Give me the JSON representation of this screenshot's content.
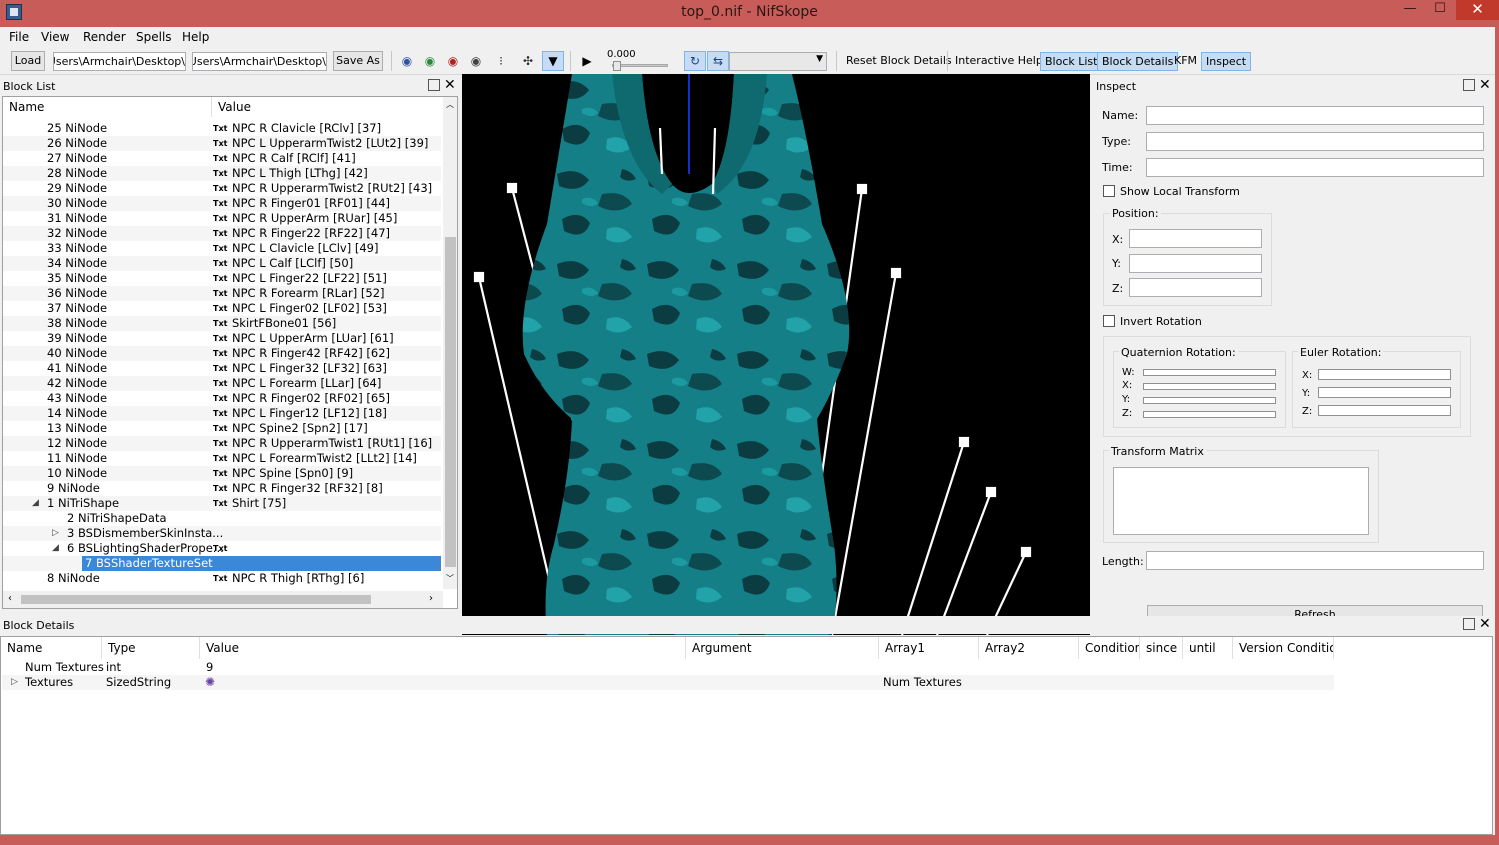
{
  "window": {
    "title": "top_0.nif - NifSkope",
    "min_glyph": "—",
    "max_glyph": "☐",
    "close_glyph": "✕"
  },
  "menu": [
    "File",
    "View",
    "Render",
    "Spells",
    "Help"
  ],
  "toolbar": {
    "load": "Load",
    "path1": "\\Users\\Armchair\\Desktop\\",
    "path2": "\\Users\\Armchair\\Desktop\\",
    "save_as": "Save As",
    "time_value": "0.000",
    "reset_block_details": "Reset Block Details",
    "interactive_help": "Interactive Help",
    "block_list": "Block List",
    "block_details": "Block Details",
    "kfm": "KFM",
    "inspect": "Inspect"
  },
  "block_list": {
    "title": "Block List",
    "col_name": "Name",
    "col_value": "Value",
    "txt_tag": "Txt",
    "rows": [
      {
        "name": "25 NiNode",
        "value": "NPC R Clavicle [RClv] [37]",
        "indent": 0,
        "txt": true
      },
      {
        "name": "26 NiNode",
        "value": "NPC L UpperarmTwist2 [LUt2] [39]",
        "indent": 0,
        "txt": true
      },
      {
        "name": "27 NiNode",
        "value": "NPC R Calf [RClf] [41]",
        "indent": 0,
        "txt": true
      },
      {
        "name": "28 NiNode",
        "value": "NPC L Thigh [LThg] [42]",
        "indent": 0,
        "txt": true
      },
      {
        "name": "29 NiNode",
        "value": "NPC R UpperarmTwist2 [RUt2] [43]",
        "indent": 0,
        "txt": true
      },
      {
        "name": "30 NiNode",
        "value": "NPC R Finger01 [RF01] [44]",
        "indent": 0,
        "txt": true
      },
      {
        "name": "31 NiNode",
        "value": "NPC R UpperArm [RUar] [45]",
        "indent": 0,
        "txt": true
      },
      {
        "name": "32 NiNode",
        "value": "NPC R Finger22 [RF22] [47]",
        "indent": 0,
        "txt": true
      },
      {
        "name": "33 NiNode",
        "value": "NPC L Clavicle [LClv] [49]",
        "indent": 0,
        "txt": true
      },
      {
        "name": "34 NiNode",
        "value": "NPC L Calf [LClf] [50]",
        "indent": 0,
        "txt": true
      },
      {
        "name": "35 NiNode",
        "value": "NPC L Finger22 [LF22] [51]",
        "indent": 0,
        "txt": true
      },
      {
        "name": "36 NiNode",
        "value": "NPC R Forearm [RLar] [52]",
        "indent": 0,
        "txt": true
      },
      {
        "name": "37 NiNode",
        "value": "NPC L Finger02 [LF02] [53]",
        "indent": 0,
        "txt": true
      },
      {
        "name": "38 NiNode",
        "value": "SkirtFBone01 [56]",
        "indent": 0,
        "txt": true
      },
      {
        "name": "39 NiNode",
        "value": "NPC L UpperArm [LUar] [61]",
        "indent": 0,
        "txt": true
      },
      {
        "name": "40 NiNode",
        "value": "NPC R Finger42 [RF42] [62]",
        "indent": 0,
        "txt": true
      },
      {
        "name": "41 NiNode",
        "value": "NPC L Finger32 [LF32] [63]",
        "indent": 0,
        "txt": true
      },
      {
        "name": "42 NiNode",
        "value": "NPC L Forearm [LLar] [64]",
        "indent": 0,
        "txt": true
      },
      {
        "name": "43 NiNode",
        "value": "NPC R Finger02 [RF02] [65]",
        "indent": 0,
        "txt": true
      },
      {
        "name": "14 NiNode",
        "value": "NPC L Finger12 [LF12] [18]",
        "indent": 0,
        "txt": true
      },
      {
        "name": "13 NiNode",
        "value": "NPC Spine2 [Spn2] [17]",
        "indent": 0,
        "txt": true
      },
      {
        "name": "12 NiNode",
        "value": "NPC R UpperarmTwist1 [RUt1] [16]",
        "indent": 0,
        "txt": true
      },
      {
        "name": "11 NiNode",
        "value": "NPC L ForearmTwist2 [LLt2] [14]",
        "indent": 0,
        "txt": true
      },
      {
        "name": "10 NiNode",
        "value": "NPC Spine [Spn0] [9]",
        "indent": 0,
        "txt": true
      },
      {
        "name": "9 NiNode",
        "value": "NPC R Finger32 [RF32] [8]",
        "indent": 0,
        "txt": true
      },
      {
        "name": "1 NiTriShape",
        "value": "Shirt [75]",
        "indent": 0,
        "txt": true,
        "expander": "◢"
      },
      {
        "name": "2 NiTriShapeData",
        "value": "",
        "indent": 1,
        "txt": false
      },
      {
        "name": "3 BSDismemberSkinInsta...",
        "value": "",
        "indent": 1,
        "txt": false,
        "expander": "▷"
      },
      {
        "name": "6 BSLightingShaderPrope...",
        "value": "",
        "indent": 1,
        "txt": true,
        "expander": "◢"
      },
      {
        "name": "7 BSShaderTextureSet",
        "value": "",
        "indent": 2,
        "txt": false,
        "selected": true
      },
      {
        "name": "8 NiNode",
        "value": "NPC R Thigh [RThg] [6]",
        "indent": 0,
        "txt": true
      }
    ]
  },
  "inspect": {
    "title": "Inspect",
    "name_label": "Name:",
    "type_label": "Type:",
    "time_label": "Time:",
    "show_local_transform": "Show Local Transform",
    "position_label": "Position:",
    "x_label": "X:",
    "y_label": "Y:",
    "z_label": "Z:",
    "invert_rotation": "Invert Rotation",
    "quaternion_label": "Quaternion Rotation:",
    "w_label": "W:",
    "euler_label": "Euler Rotation:",
    "transform_matrix_label": "Transform Matrix",
    "length_label": "Length:",
    "refresh": "Refresh"
  },
  "block_details": {
    "title": "Block Details",
    "columns": [
      "Name",
      "Type",
      "Value",
      "Argument",
      "Array1",
      "Array2",
      "Condition",
      "since",
      "until",
      "Version Condition"
    ],
    "rows": [
      {
        "name": "Num Textures",
        "type": "int",
        "value": "9",
        "argument": "",
        "array1": ""
      },
      {
        "name": "Textures",
        "type": "SizedString",
        "value": "",
        "argument": "",
        "array1": "Num Textures",
        "expander": "▷"
      }
    ]
  },
  "colors": {
    "title_bar": "#c75c58",
    "selection": "#3b87d8",
    "mesh": "#147f86",
    "mesh_dark": "#0b3c42",
    "bones": "#ffffff",
    "viewport_bg": "#000000"
  }
}
